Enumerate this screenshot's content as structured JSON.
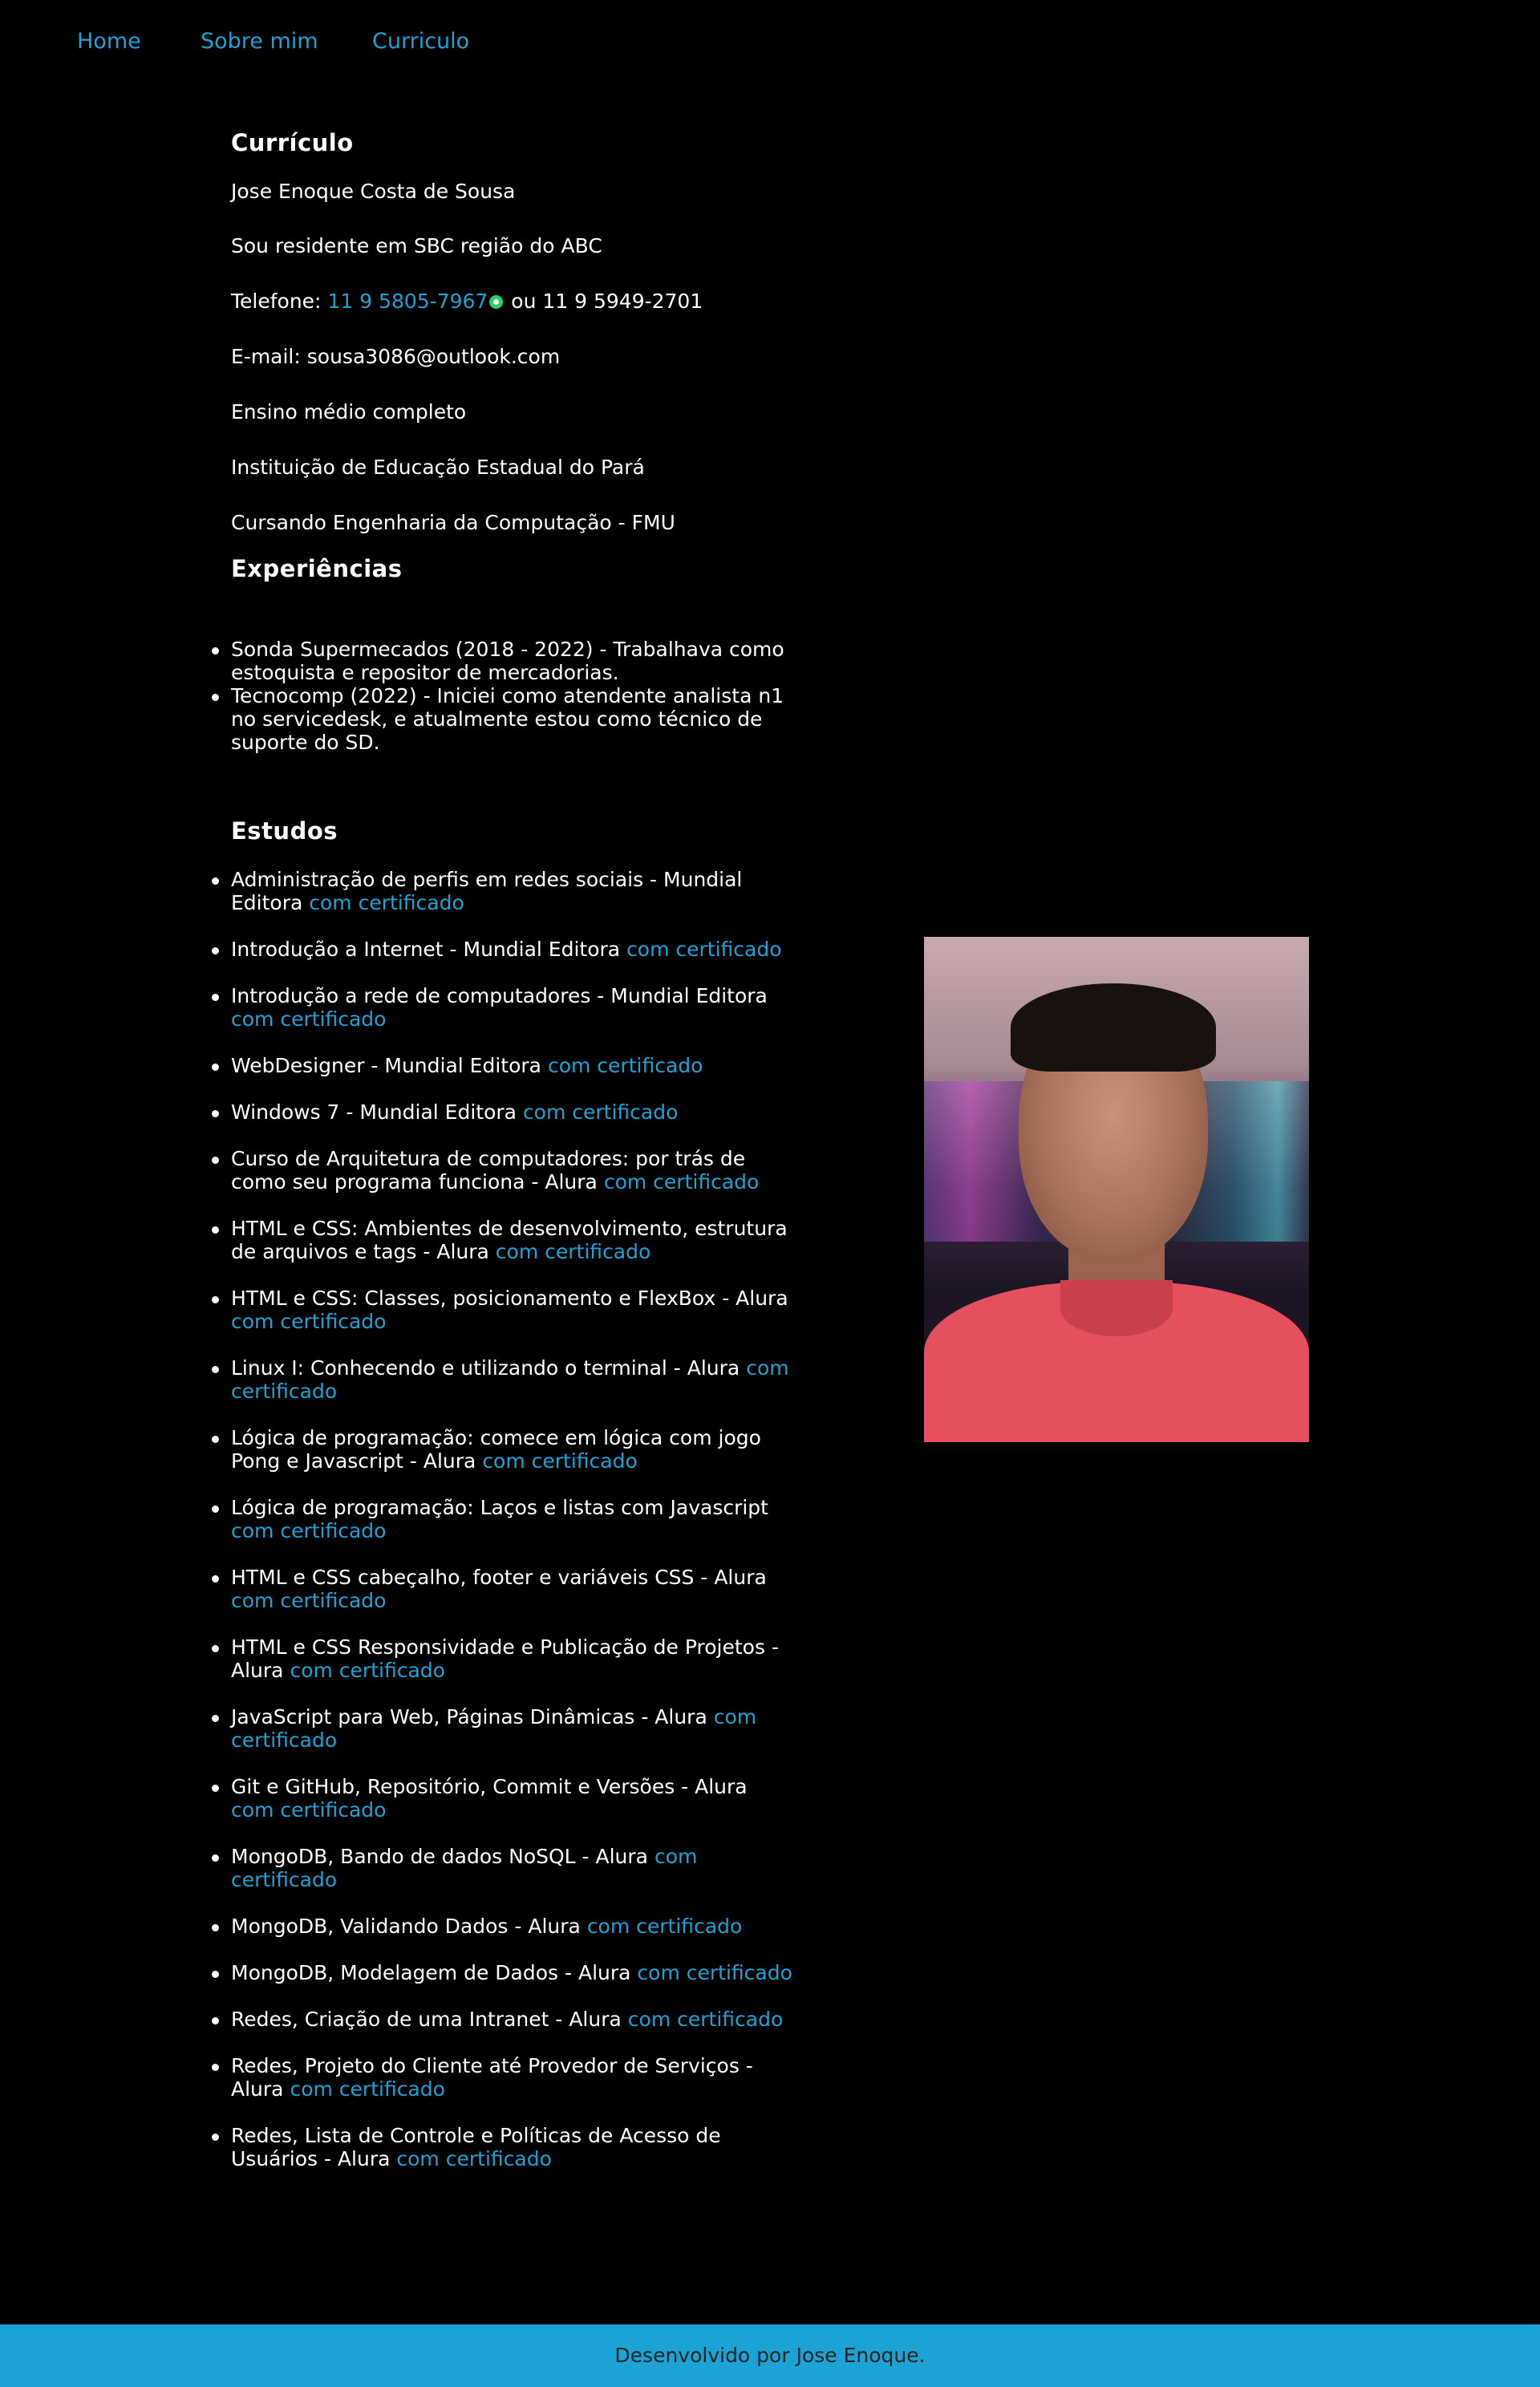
{
  "nav": {
    "home": "Home",
    "sobre": "Sobre mim",
    "curriculo": "Curriculo"
  },
  "curriculo": {
    "title": "Currículo",
    "name": "Jose Enoque Costa de Sousa",
    "residence": "Sou residente em SBC região do ABC",
    "phone_label": "Telefone:",
    "phone_link": "11 9 5805-7967",
    "phone_or": "ou 11 9 5949-2701",
    "email": "E-mail: sousa3086@outlook.com",
    "school": "Ensino médio completo",
    "institution": "Instituição de Educação Estadual do Pará",
    "college": "Cursando Engenharia da Computação - FMU"
  },
  "experiencias": {
    "title": "Experiências",
    "items": [
      "Sonda Supermecados (2018 - 2022) - Trabalhava como estoquista e repositor de mercadorias.",
      "Tecnocomp (2022) - Iniciei como atendente analista n1 no servicedesk, e atualmente estou como técnico de suporte do SD."
    ]
  },
  "estudos": {
    "title": "Estudos",
    "link_label": "com certificado",
    "items": [
      "Administração de perfis em redes sociais - Mundial Editora",
      "Introdução a Internet - Mundial Editora",
      "Introdução a rede de computadores - Mundial Editora",
      "WebDesigner - Mundial Editora",
      "Windows 7 - Mundial Editora",
      "Curso de Arquitetura de computadores: por trás de como seu programa funciona - Alura",
      "HTML e CSS: Ambientes de desenvolvimento, estrutura de arquivos e tags - Alura",
      "HTML e CSS: Classes, posicionamento e FlexBox - Alura",
      "Linux I: Conhecendo e utilizando o terminal - Alura",
      "Lógica de programação: comece em lógica com jogo Pong e Javascript - Alura",
      "Lógica de programação: Laços e listas com Javascript",
      "HTML e CSS cabeçalho, footer e variáveis CSS - Alura",
      "HTML e CSS Responsividade e Publicação de Projetos - Alura",
      "JavaScript para Web, Páginas Dinâmicas - Alura",
      "Git e GitHub, Repositório, Commit e Versões - Alura",
      "MongoDB, Bando de dados NoSQL - Alura",
      "MongoDB, Validando Dados - Alura",
      "MongoDB, Modelagem de Dados - Alura",
      "Redes, Criação de uma Intranet - Alura",
      "Redes, Projeto do Cliente até Provedor de Serviços - Alura",
      "Redes, Lista de Controle e Políticas de Acesso de Usuários - Alura"
    ]
  },
  "footer": {
    "text": "Desenvolvido por Jose Enoque."
  },
  "colors": {
    "background": "#000000",
    "accent": "#1ba3d6",
    "text": "#ffffff"
  }
}
